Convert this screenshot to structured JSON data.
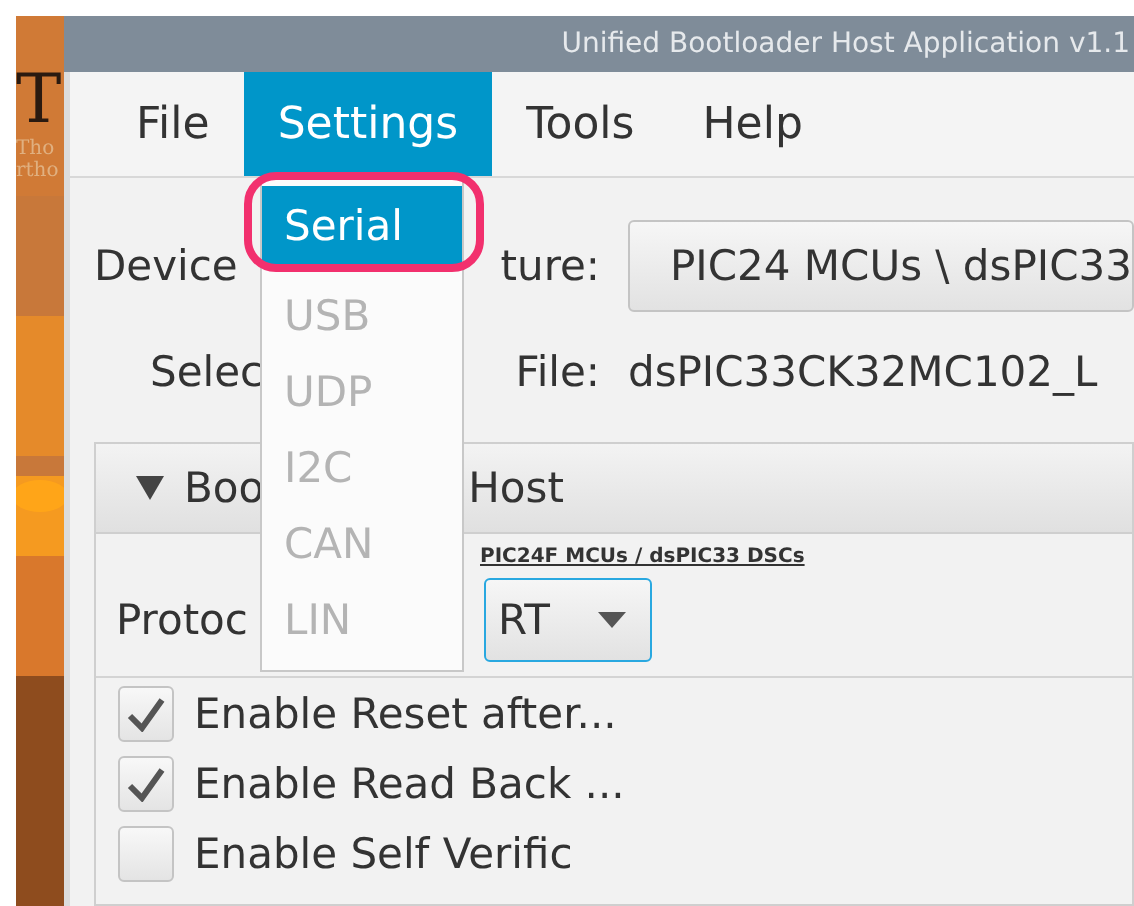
{
  "behind_window": {
    "texts": [
      "T",
      "Tho",
      "rtho"
    ]
  },
  "window": {
    "title": "Unified Bootloader Host Application v1.1"
  },
  "menu_bar": [
    {
      "label": "File",
      "selected": false
    },
    {
      "label": "Settings",
      "selected": true
    },
    {
      "label": "Tools",
      "selected": false
    },
    {
      "label": "Help",
      "selected": false
    }
  ],
  "settings_menu": {
    "items": [
      {
        "label": "Serial",
        "selected": true,
        "disabled": false
      },
      {
        "label": "USB",
        "selected": false,
        "disabled": true
      },
      {
        "label": "UDP",
        "selected": false,
        "disabled": true
      },
      {
        "label": "I2C",
        "selected": false,
        "disabled": true
      },
      {
        "label": "CAN",
        "selected": false,
        "disabled": true
      },
      {
        "label": "LIN",
        "selected": false,
        "disabled": true
      }
    ]
  },
  "device_architecture": {
    "label_parts": [
      "Device",
      "ture:"
    ],
    "value": "PIC24 MCUs \\ dsPIC33"
  },
  "selected_file": {
    "label_parts": [
      "Selec",
      "File:"
    ],
    "value": "dsPIC33CK32MC102_L"
  },
  "bootloader_pane": {
    "title_parts": [
      "Boo",
      "Host"
    ],
    "expanded": true,
    "device_family": "PIC24F MCUs / dsPIC33 DSCs",
    "protocol": {
      "label": "Protoc",
      "value": "RT"
    },
    "options": [
      {
        "label": "Enable Reset after...",
        "checked": true
      },
      {
        "label": "Enable Read Back ...",
        "checked": true
      },
      {
        "label": "Enable Self Verific",
        "checked": false
      }
    ]
  }
}
